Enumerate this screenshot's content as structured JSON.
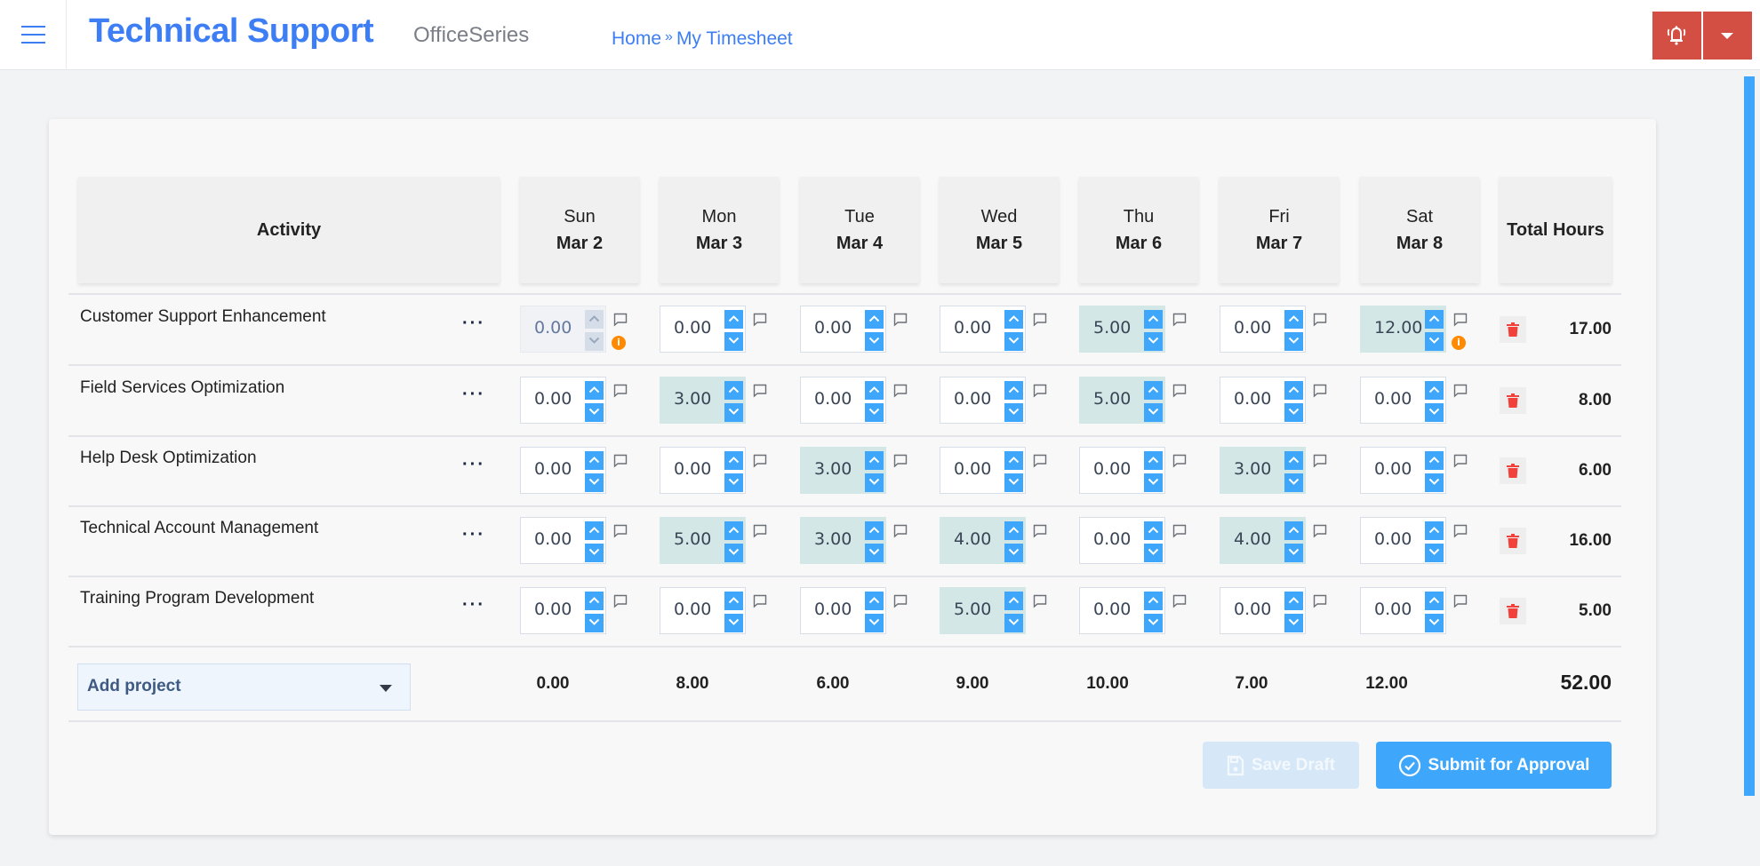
{
  "header": {
    "app_title": "Technical Support",
    "app_subtitle": "OfficeSeries",
    "breadcrumb": [
      {
        "label": "Home"
      },
      {
        "label": "My Timesheet"
      }
    ],
    "breadcrumb_separator": "»",
    "icons": {
      "menu": "hamburger-icon",
      "alert": "bell-ring-icon",
      "dropdown": "caret-down-icon"
    },
    "colors": {
      "brand": "#3d7ef5",
      "alert": "#d44f43"
    }
  },
  "timesheet": {
    "columns": {
      "activity": "Activity",
      "total": "Total Hours",
      "days": [
        {
          "day": "Sun",
          "date": "Mar 2"
        },
        {
          "day": "Mon",
          "date": "Mar 3"
        },
        {
          "day": "Tue",
          "date": "Mar 4"
        },
        {
          "day": "Wed",
          "date": "Mar 5"
        },
        {
          "day": "Thu",
          "date": "Mar 6"
        },
        {
          "day": "Fri",
          "date": "Mar 7"
        },
        {
          "day": "Sat",
          "date": "Mar 8"
        }
      ]
    },
    "rows": [
      {
        "activity": "Customer Support Enhancement",
        "hours": [
          "0.00",
          "0.00",
          "0.00",
          "0.00",
          "5.00",
          "0.00",
          "12.00"
        ],
        "disabled_days": [
          0
        ],
        "info_days": [
          0,
          6
        ],
        "total": "17.00"
      },
      {
        "activity": "Field Services Optimization",
        "hours": [
          "0.00",
          "3.00",
          "0.00",
          "0.00",
          "5.00",
          "0.00",
          "0.00"
        ],
        "disabled_days": [],
        "info_days": [],
        "total": "8.00"
      },
      {
        "activity": "Help Desk Optimization",
        "hours": [
          "0.00",
          "0.00",
          "3.00",
          "0.00",
          "0.00",
          "3.00",
          "0.00"
        ],
        "disabled_days": [],
        "info_days": [],
        "total": "6.00"
      },
      {
        "activity": "Technical Account Management",
        "hours": [
          "0.00",
          "5.00",
          "3.00",
          "4.00",
          "0.00",
          "4.00",
          "0.00"
        ],
        "disabled_days": [],
        "info_days": [],
        "total": "16.00"
      },
      {
        "activity": "Training Program Development",
        "hours": [
          "0.00",
          "0.00",
          "0.00",
          "5.00",
          "0.00",
          "0.00",
          "0.00"
        ],
        "disabled_days": [],
        "info_days": [],
        "total": "5.00"
      }
    ],
    "row_menu_label": "···",
    "info_glyph": "i",
    "add_project_label": "Add project",
    "day_totals": [
      "0.00",
      "8.00",
      "6.00",
      "9.00",
      "10.00",
      "7.00",
      "12.00"
    ],
    "grand_total": "52.00"
  },
  "actions": {
    "save_draft": "Save Draft",
    "submit": "Submit for Approval"
  },
  "colors": {
    "primary": "#3ea6fb",
    "filled_cell": "#d3e7e6",
    "info": "#ff8a00",
    "delete": "#f2413a"
  }
}
